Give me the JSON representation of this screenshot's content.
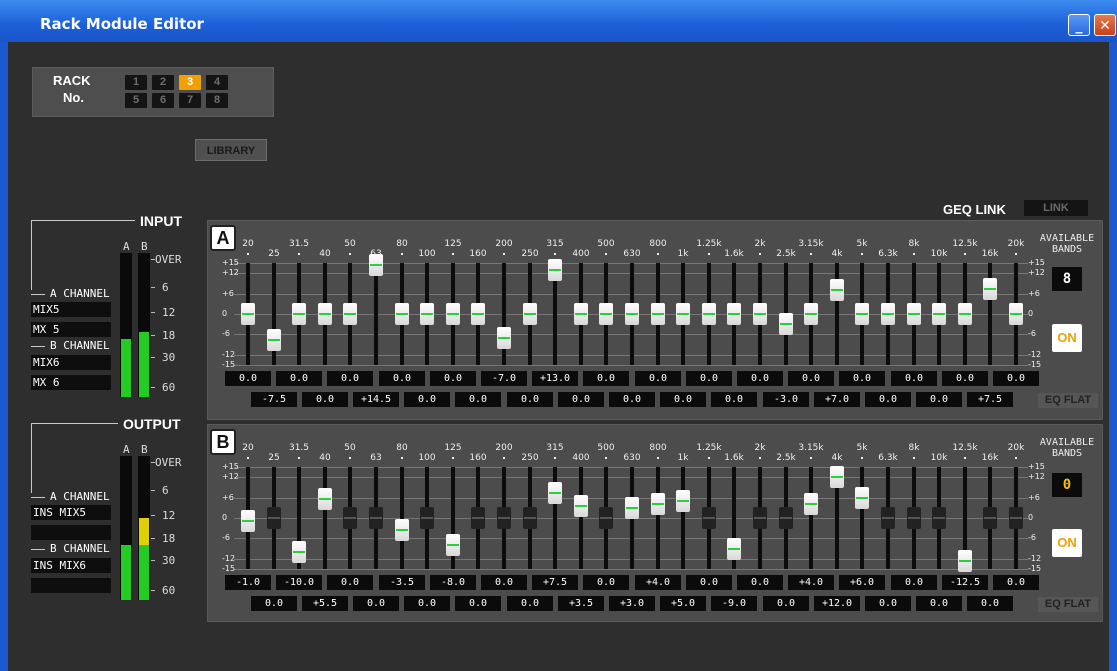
{
  "window": {
    "title": "Rack Module Editor"
  },
  "rack": {
    "label_line1": "RACK",
    "label_line2": "No.",
    "buttons": [
      "1",
      "2",
      "3",
      "4",
      "5",
      "6",
      "7",
      "8"
    ],
    "selected": "3"
  },
  "library_label": "LIBRARY",
  "geq_link": {
    "label": "GEQ LINK",
    "button": "LINK"
  },
  "input": {
    "title": "INPUT",
    "meter_labels": {
      "a": "A",
      "b": "B"
    },
    "scale": [
      "OVER",
      "6",
      "12",
      "18",
      "30",
      "60"
    ],
    "a_channel_label": "A CHANNEL",
    "a_channel_values": [
      "MIX5",
      "MX 5"
    ],
    "b_channel_label": "B CHANNEL",
    "b_channel_values": [
      "MIX6",
      "MX 6"
    ],
    "meter_level": {
      "a": 0.4,
      "b": 0.45
    }
  },
  "output": {
    "title": "OUTPUT",
    "meter_labels": {
      "a": "A",
      "b": "B"
    },
    "scale": [
      "OVER",
      "6",
      "12",
      "18",
      "30",
      "60"
    ],
    "a_channel_label": "A CHANNEL",
    "a_channel_values": [
      "INS MIX5",
      ""
    ],
    "b_channel_label": "B CHANNEL",
    "b_channel_values": [
      "INS MIX6",
      ""
    ],
    "meter_level": {
      "a": 0.38,
      "b": 0.57
    }
  },
  "frequencies": [
    "20",
    "25",
    "31.5",
    "40",
    "50",
    "63",
    "80",
    "100",
    "125",
    "160",
    "200",
    "250",
    "315",
    "400",
    "500",
    "630",
    "800",
    "1k",
    "1.25k",
    "1.6k",
    "2k",
    "2.5k",
    "3.15k",
    "4k",
    "5k",
    "6.3k",
    "8k",
    "10k",
    "12.5k",
    "16k",
    "20k"
  ],
  "db_scale": [
    "+15",
    "+12",
    "+6",
    "0",
    "-6",
    "-12",
    "-15"
  ],
  "geq_a": {
    "letter": "A",
    "gains": [
      0.0,
      -7.5,
      0.0,
      0.0,
      0.0,
      14.5,
      0.0,
      0.0,
      0.0,
      0.0,
      -7.0,
      0.0,
      13.0,
      0.0,
      0.0,
      0.0,
      0.0,
      0.0,
      0.0,
      0.0,
      0.0,
      -3.0,
      0.0,
      7.0,
      0.0,
      0.0,
      0.0,
      0.0,
      0.0,
      7.5,
      0.0
    ],
    "active": [
      true,
      true,
      true,
      true,
      true,
      true,
      true,
      true,
      true,
      true,
      true,
      true,
      true,
      true,
      true,
      true,
      true,
      true,
      true,
      true,
      true,
      true,
      true,
      true,
      true,
      true,
      true,
      true,
      true,
      true,
      true
    ],
    "row1": [
      "0.0",
      "0.0",
      "0.0",
      "0.0",
      "0.0",
      "-7.0",
      "+13.0",
      "0.0",
      "0.0",
      "0.0",
      "0.0",
      "0.0",
      "0.0",
      "0.0",
      "0.0",
      "0.0"
    ],
    "row2": [
      "-7.5",
      "0.0",
      "+14.5",
      "0.0",
      "0.0",
      "0.0",
      "0.0",
      "0.0",
      "0.0",
      "0.0",
      "-3.0",
      "+7.0",
      "0.0",
      "0.0",
      "+7.5"
    ],
    "available_label_1": "AVAILABLE",
    "available_label_2": "BANDS",
    "available_value": "8",
    "on_label": "ON",
    "eq_flat_label": "EQ FLAT"
  },
  "geq_b": {
    "letter": "B",
    "gains": [
      -1.0,
      0.0,
      -10.0,
      5.5,
      0.0,
      0.0,
      -3.5,
      0.0,
      -8.0,
      0.0,
      0.0,
      0.0,
      7.5,
      3.5,
      0.0,
      3.0,
      4.0,
      5.0,
      0.0,
      -9.0,
      0.0,
      0.0,
      4.0,
      12.0,
      6.0,
      0.0,
      0.0,
      0.0,
      -12.5,
      0.0,
      0.0
    ],
    "active": [
      true,
      false,
      true,
      true,
      false,
      false,
      true,
      false,
      true,
      false,
      false,
      false,
      true,
      true,
      false,
      true,
      true,
      true,
      false,
      true,
      false,
      false,
      true,
      true,
      true,
      false,
      false,
      false,
      true,
      false,
      false
    ],
    "row1": [
      "-1.0",
      "-10.0",
      "0.0",
      "-3.5",
      "-8.0",
      "0.0",
      "+7.5",
      "0.0",
      "+4.0",
      "0.0",
      "0.0",
      "+4.0",
      "+6.0",
      "0.0",
      "-12.5",
      "0.0"
    ],
    "row2": [
      "0.0",
      "+5.5",
      "0.0",
      "0.0",
      "0.0",
      "0.0",
      "+3.5",
      "+3.0",
      "+5.0",
      "-9.0",
      "0.0",
      "+12.0",
      "0.0",
      "0.0",
      "0.0"
    ],
    "available_label_1": "AVAILABLE",
    "available_label_2": "BANDS",
    "available_value": "0",
    "on_label": "ON",
    "eq_flat_label": "EQ FLAT"
  },
  "colors": {
    "selected_rack": "#f0a000",
    "on_text": "#f0a000",
    "avail_zero": "#f0c000",
    "meter_green": "#22cc22",
    "meter_yellow": "#e0d000"
  }
}
